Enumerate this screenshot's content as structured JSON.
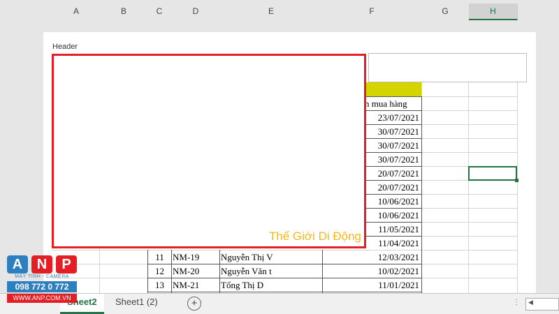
{
  "columns": [
    "A",
    "B",
    "C",
    "D",
    "E",
    "F",
    "G",
    "H"
  ],
  "active_column": "H",
  "header_label": "Header",
  "partial_header": "n mua hàng",
  "header_fill_color": "#d4d400",
  "dates_visible": [
    "23/07/2021",
    "30/07/2021",
    "30/07/2021",
    "30/07/2021",
    "20/07/2021",
    "20/07/2021",
    "10/06/2021",
    "10/06/2021",
    "11/05/2021",
    "11/04/2021"
  ],
  "rows": [
    {
      "stt": "11",
      "code": "NM-19",
      "name": "Nguyễn Thị V",
      "date": "12/03/2021"
    },
    {
      "stt": "12",
      "code": "NM-20",
      "name": "Nguyễn Văn t",
      "date": "10/02/2021"
    },
    {
      "stt": "13",
      "code": "NM-21",
      "name": "Tổng Thị D",
      "date": "11/01/2021"
    }
  ],
  "overlay_text": "Thế Giới Di Động",
  "sheet_tabs": [
    {
      "label": "Sheet2",
      "active": true
    },
    {
      "label": "Sheet1 (2)",
      "active": false
    }
  ],
  "add_sheet_icon": "plus-circle-icon",
  "logo": {
    "letters": [
      "A",
      "N",
      "P"
    ],
    "tagline": "MÁY TÍNH - CAMERA",
    "phone": "098 772 0 772",
    "website": "WWW.ANP.COM.VN"
  }
}
